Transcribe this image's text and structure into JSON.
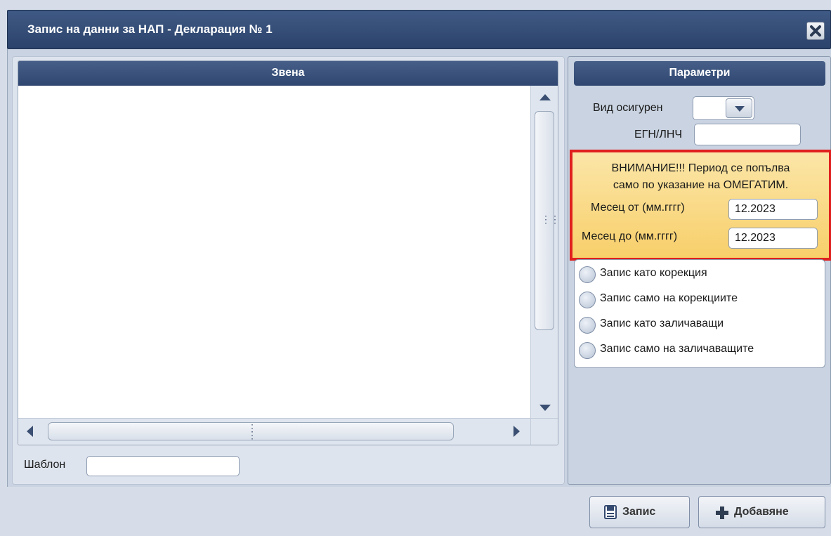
{
  "window": {
    "title": "Запис на данни за НАП - Декларация № 1"
  },
  "grid": {
    "header": "Звена"
  },
  "template": {
    "label": "Шаблон",
    "value": ""
  },
  "params": {
    "header": "Параметри",
    "insured_type_label": "Вид осигурен",
    "insured_type_value": "",
    "egn_label": "ЕГН/ЛНЧ",
    "egn_value": "",
    "warning_line1": "ВНИМАНИЕ!!! Период се попълва",
    "warning_line2": "само по указание на ОМЕГАТИМ.",
    "month_from_label": "Месец от (мм.гггг)",
    "month_from_value": "12.2023",
    "month_to_label": "Месец до (мм.гггг)",
    "month_to_value": "12.2023",
    "options": [
      "Запис като корекция",
      "Запис само на корекциите",
      "Запис като заличаващи",
      "Запис само на заличаващите"
    ]
  },
  "buttons": {
    "save": "Запис",
    "add": "Добавяне"
  },
  "icons": {
    "close": "close-icon",
    "save": "save-icon",
    "add": "plus-icon",
    "dropdown": "chevron-down-icon"
  },
  "colors": {
    "header": "#34496f",
    "warning_bg": "#f9d67a",
    "warning_border": "#e0201f"
  }
}
